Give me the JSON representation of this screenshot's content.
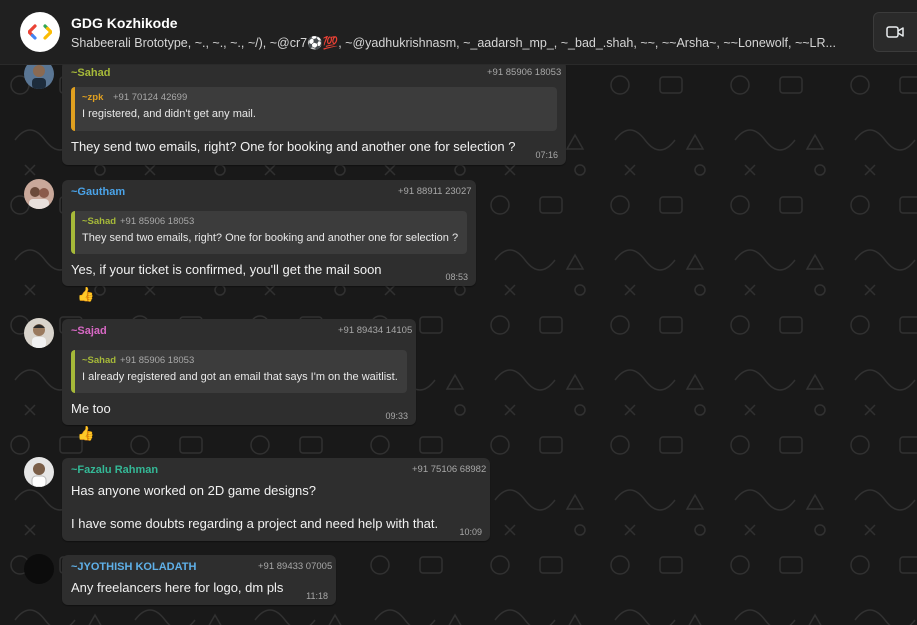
{
  "header": {
    "title": "GDG Kozhikode",
    "members": "Shabeerali Brototype, ~., ~., ~., ~/), ~@cr7⚽💯, ~@yadhukrishnasm, ~_aadarsh_mp_, ~_bad_.shah, ~~, ~~Arsha~, ~~Lonewolf, ~~LR..."
  },
  "messages": [
    {
      "sender": "~Sahad",
      "phone": "+91 85906 18053",
      "quote": {
        "sender": "~zpk",
        "phone": "+91 70124 42699",
        "text": "I registered, and didn't get any mail."
      },
      "text": "They send two emails, right? One for booking and another one for selection ?",
      "time": "07:16"
    },
    {
      "sender": "~Gautham",
      "phone": "+91 88911 23027",
      "quote": {
        "sender": "~Sahad",
        "phone": "+91 85906 18053",
        "text": "They send two emails, right? One for booking and another one for selection ?"
      },
      "text": "Yes, if your ticket is confirmed, you'll get the mail soon",
      "time": "08:53",
      "reaction": "👍"
    },
    {
      "sender": "~Sajad",
      "phone": "+91 89434 14105",
      "quote": {
        "sender": "~Sahad",
        "phone": "+91 85906 18053",
        "text": "I already registered and got an email that says I'm on the waitlist."
      },
      "text": "Me too",
      "time": "09:33",
      "reaction": "👍"
    },
    {
      "sender": "~Fazalu Rahman",
      "phone": "+91 75106 68982",
      "text_line1": "Has anyone worked on 2D game designs?",
      "text_line2": "I have some doubts regarding a project and need help with that.",
      "time": "10:09"
    },
    {
      "sender": "~JYOTHISH KOLADATH",
      "phone": "+91 89433 07005",
      "text": "Any freelancers here for  logo, dm pls",
      "time": "11:18"
    }
  ],
  "colors": {
    "sahad": "#a6b939",
    "zpk": "#e0a020",
    "gautham": "#4aa3e8",
    "sajad": "#d768c4",
    "fazalu": "#34b896",
    "jyothish": "#5fb0e8"
  },
  "icons": {
    "video": "video-camera-icon",
    "group": "code-brackets-logo-icon",
    "reaction": "thumbs-up"
  }
}
